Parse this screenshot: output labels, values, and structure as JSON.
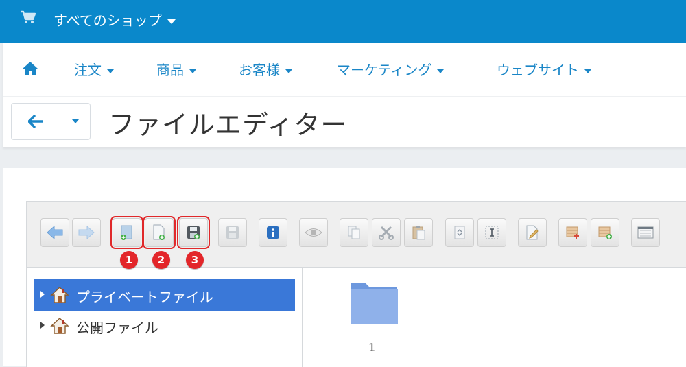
{
  "topbar": {
    "shop_label": "すべてのショップ",
    "cart_icon": "cart-icon"
  },
  "nav": {
    "home_icon": "home-icon",
    "items": [
      {
        "label": "注文"
      },
      {
        "label": "商品"
      },
      {
        "label": "お客様"
      },
      {
        "label": "マーケティング"
      },
      {
        "label": "ウェブサイト"
      }
    ]
  },
  "page": {
    "title": "ファイルエディター"
  },
  "toolbar": {
    "buttons": [
      {
        "icon": "arrow-left-icon"
      },
      {
        "icon": "arrow-right-icon"
      },
      {
        "icon": "new-folder-icon",
        "badge": "1"
      },
      {
        "icon": "new-file-icon",
        "badge": "2"
      },
      {
        "icon": "upload-save-icon",
        "badge": "3"
      },
      {
        "icon": "save-icon"
      },
      {
        "icon": "info-icon"
      },
      {
        "icon": "preview-eye-icon"
      },
      {
        "icon": "copy-icon"
      },
      {
        "icon": "cut-icon"
      },
      {
        "icon": "paste-icon"
      },
      {
        "icon": "duplicate-icon"
      },
      {
        "icon": "rename-icon"
      },
      {
        "icon": "edit-icon"
      },
      {
        "icon": "extract-icon"
      },
      {
        "icon": "archive-icon"
      },
      {
        "icon": "view-icon"
      }
    ],
    "badges": [
      "1",
      "2",
      "3"
    ]
  },
  "tree": {
    "items": [
      {
        "label": "プライベートファイル",
        "selected": true
      },
      {
        "label": "公開ファイル",
        "selected": false
      }
    ]
  },
  "files": [
    {
      "name": "1",
      "icon": "folder-icon"
    }
  ],
  "colors": {
    "topbar": "#0a88cb",
    "link": "#1a86c7",
    "selected": "#3a78d8",
    "badge": "#e3262a"
  }
}
